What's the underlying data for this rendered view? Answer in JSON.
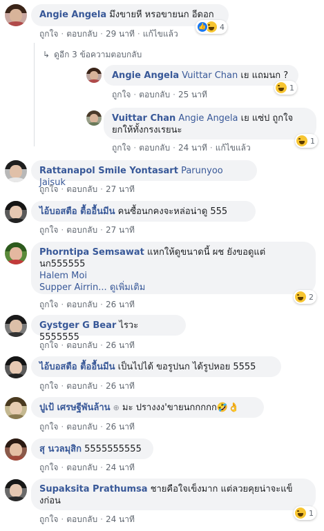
{
  "colors": {
    "author": "#385898",
    "bubble": "#f2f3f5",
    "meta": "#606770",
    "haha": "#f7c531",
    "like": "#1877f2"
  },
  "icons": {
    "like": "like-icon",
    "haha": "haha-icon",
    "reply-arrow": "reply-arrow-icon"
  },
  "c1": {
    "author": "Angie Angela",
    "text": "มึงขายหี หรอขายนก อีดอก",
    "like": "ถูกใจ",
    "reply": "ตอบกลับ",
    "time": "29 นาที",
    "edited": "แก้ไขแล้ว",
    "reactions": "4"
  },
  "more_replies": "ดูอีก 3 ข้อความตอบกลับ",
  "r1": {
    "author": "Angie Angela",
    "mention": "Vuittar Chan",
    "text": "เย แถมนก ?",
    "like": "ถูกใจ",
    "reply": "ตอบกลับ",
    "time": "25 นาที",
    "reactions": "1"
  },
  "r2": {
    "author": "Vuittar Chan",
    "mention": "Angie Angela",
    "text": "เย แซ่ป ถูกใจ",
    "text2": "ยกให้ทั้งกรงเรยนะ",
    "like": "ถูกใจ",
    "reply": "ตอบกลับ",
    "time": "24 นาที",
    "edited": "แก้ไขแล้ว",
    "reactions": "1"
  },
  "c2": {
    "author": "Rattanapol Smile Yontasart",
    "mention": "Parunyoo Jaisuk",
    "like": "ถูกใจ",
    "reply": "ตอบกลับ",
    "time": "27 นาที"
  },
  "c3": {
    "author": "ไอ้บอสตือ ตื้ออื้นมีน",
    "text": "คนซื้อนกคงจะหล่อน่าดู 555",
    "like": "ถูกใจ",
    "reply": "ตอบกลับ",
    "time": "27 นาที"
  },
  "c4": {
    "author": "Phorntipa Semsawat",
    "text": "แหกให้ดูขนาดนี้ ผช ยังขอดูแต่",
    "text2": "นก555555",
    "mention1": "Halem Moi",
    "mention2": "Supper Airrin...",
    "seemore": "ดูเพิ่มเติม",
    "like": "ถูกใจ",
    "reply": "ตอบกลับ",
    "time": "26 นาที",
    "reactions": "2"
  },
  "c5": {
    "author": "Gystger G Bear",
    "text": "ไรวะ 5555555",
    "like": "ถูกใจ",
    "reply": "ตอบกลับ",
    "time": "26 นาที"
  },
  "c6": {
    "author": "ไอ้บอสตือ ตื้ออื้นมีน",
    "text": "เป็นไปได้ ขอรูปนก ได้รูปหอย 5555",
    "like": "ถูกใจ",
    "reply": "ตอบกลับ",
    "time": "26 นาที"
  },
  "c7": {
    "author": "ปูเป้ เศรษฐีพันล้าน",
    "text": "มะ ปรางงง'ขายนกกกกก",
    "emoji": "🤣👌",
    "like": "ถูกใจ",
    "reply": "ตอบกลับ",
    "time": "26 นาที"
  },
  "c8": {
    "author": "สุ นวลมุสิก",
    "text": "5555555555",
    "like": "ถูกใจ",
    "reply": "ตอบกลับ",
    "time": "24 นาที"
  },
  "c9": {
    "author": "Supaksita Prathumsa",
    "text": "ชายคือใจเข็งมาก แต่ลวยคุยน่าจะแข็",
    "text2": "งก่อน",
    "like": "ถูกใจ",
    "reply": "ตอบกลับ",
    "time": "24 นาที",
    "reactions": "1"
  }
}
